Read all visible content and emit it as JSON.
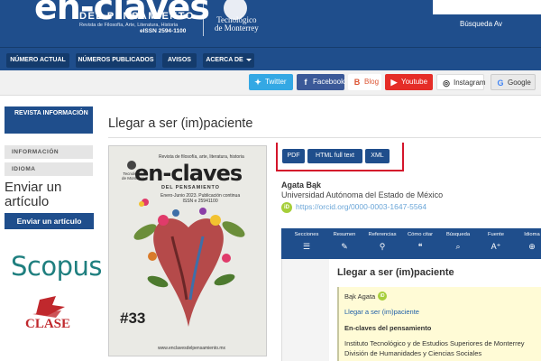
{
  "header": {
    "logo_main": "en-claves",
    "logo_sub": "DEL PENSAMIENTO",
    "logo_desc": "Revista de Filosofía, Arte, Literatura, Historia",
    "logo_issn": "eISSN 2594-1100",
    "institution_line1": "Tecnológico",
    "institution_line2": "de Monterrey",
    "search_advanced": "Búsqueda Av"
  },
  "nav": {
    "items": [
      "NÚMERO ACTUAL",
      "NÚMEROS PUBLICADOS",
      "AVISOS",
      "ACERCA DE"
    ]
  },
  "social": {
    "twitter": "Twitter",
    "facebook": "Facebook",
    "blog": "Blog",
    "youtube": "Youtube",
    "instagram": "Instagram",
    "google": "Google"
  },
  "sidebar": {
    "revista_info": "REVISTA INFORMACIÓN",
    "tabs": [
      "INFORMACIÓN",
      "IDIOMA"
    ],
    "enviar_title": "Enviar un artículo",
    "enviar_button": "Enviar un artículo",
    "scopus": "Scopus",
    "clase": "CLASE"
  },
  "article": {
    "title": "Llegar a ser (im)paciente",
    "formats": [
      "PDF",
      "HTML full text",
      "XML"
    ],
    "author": "Agata Bąk",
    "affiliation": "Universidad Autónoma del Estado de México",
    "orcid_url": "https://orcid.org/0000-0003-1647-5564"
  },
  "cover": {
    "top_text": "Revista de filosofía, arte, literatura, historia",
    "title": "en-claves",
    "subtitle": "DEL PENSAMIENTO",
    "date_line1": "Enero-Junio 2023. Publicación continua",
    "date_line2": "ISSN e 25941100",
    "tec_line1": "Tecnológico",
    "tec_line2": "de Monterrey",
    "number": "#33",
    "url": "www.enclavesdelpensamiento.mx"
  },
  "reader": {
    "tools": [
      "Secciones",
      "Resumen",
      "Referencias",
      "Cómo citar",
      "Búsqueda",
      "Fuente",
      "Idioma"
    ],
    "title": "Llegar a ser (im)paciente",
    "author": "Bąk Agata",
    "link": "Llegar a ser (im)paciente",
    "journal": "En-claves del pensamiento",
    "institution_line1": "Instituto Tecnológico y de Estudios Superiores de Monterrey",
    "institution_line2": "División de Humanidades y Ciencias Sociales"
  },
  "colors": {
    "primary": "#1f4e8c",
    "highlight_box": "#d4152b",
    "orcid": "#a6ce39",
    "scopus": "#1f7f7f",
    "clase": "#c0282d"
  }
}
